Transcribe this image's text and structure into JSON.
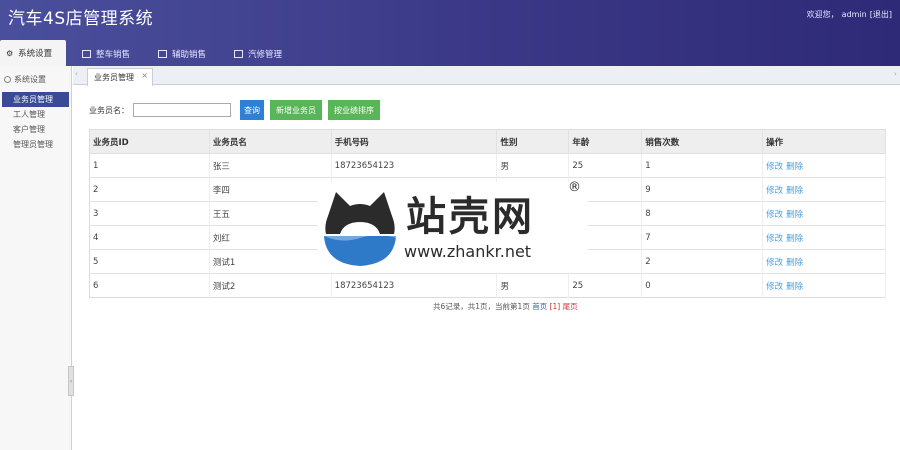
{
  "header": {
    "title": "汽车4S店管理系统",
    "welcome_prefix": "欢迎您，",
    "username": "admin",
    "logout": "[退出]"
  },
  "nav": {
    "tabs": [
      {
        "label": "系统设置",
        "active": true
      },
      {
        "label": "整车销售",
        "active": false
      },
      {
        "label": "辅助销售",
        "active": false
      },
      {
        "label": "汽修管理",
        "active": false
      }
    ]
  },
  "sidebar": {
    "title": "系统设置",
    "items": [
      {
        "label": "业务员管理",
        "active": true
      },
      {
        "label": "工人管理",
        "active": false
      },
      {
        "label": "客户管理",
        "active": false
      },
      {
        "label": "管理员管理",
        "active": false
      }
    ]
  },
  "content_tab": {
    "label": "业务员管理",
    "close": "×"
  },
  "toolbar": {
    "search_label": "业务员名：",
    "search_value": "",
    "query_button": "查询",
    "add_button": "新增业务员",
    "sort_button": "按业绩排序"
  },
  "table": {
    "headers": [
      "业务员ID",
      "业务员名",
      "手机号码",
      "性别",
      "年龄",
      "销售次数",
      "操作"
    ],
    "rows": [
      [
        "1",
        "张三",
        "18723654123",
        "男",
        "25",
        "1"
      ],
      [
        "2",
        "李四",
        "",
        "",
        "",
        "9"
      ],
      [
        "3",
        "王五",
        "",
        "",
        "",
        "8"
      ],
      [
        "4",
        "刘红",
        "",
        "",
        "",
        "7"
      ],
      [
        "5",
        "测试1",
        "",
        "",
        "",
        "2"
      ],
      [
        "6",
        "测试2",
        "18723654123",
        "男",
        "25",
        "0"
      ]
    ],
    "edit_label": "修改",
    "delete_label": "删除"
  },
  "pager": {
    "summary": "共6记录，共1页，当前第1页",
    "first": "首页",
    "current": "[1]",
    "last": "尾页"
  },
  "watermark": {
    "name": "站壳网",
    "reg": "®",
    "url": "www.zhankr.net"
  },
  "colors": {
    "header": "#3c3a88",
    "sidebar_active": "#3b4a96",
    "query_button": "#2f7fd4",
    "green_button": "#58b658",
    "action_link": "#4aa3df"
  }
}
